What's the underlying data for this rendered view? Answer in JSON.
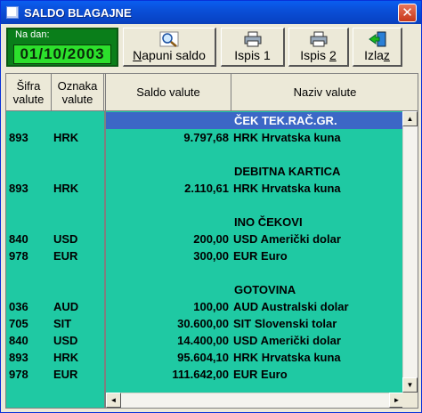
{
  "window": {
    "title": "SALDO BLAGAJNE"
  },
  "date": {
    "label": "Na dan:",
    "value": "01/10/2003"
  },
  "toolbar": {
    "fill": {
      "pre": "",
      "u": "N",
      "post": "apuni saldo"
    },
    "print1": {
      "pre": "Ispis 1",
      "u": "",
      "post": ""
    },
    "print2": {
      "pre": "Ispis ",
      "u": "2",
      "post": ""
    },
    "exit": {
      "pre": "Izla",
      "u": "z",
      "post": ""
    }
  },
  "columns": {
    "sifra": "Šifra valute",
    "oznaka": "Oznaka valute",
    "saldo": "Saldo valute",
    "naziv": "Naziv valute"
  },
  "groups": [
    {
      "name": "ČEK TEK.RAČ.GR.",
      "active": true,
      "rows": [
        {
          "sifra": "893",
          "oznaka": "HRK",
          "saldo": "9.797,68",
          "naziv": "HRK Hrvatska kuna"
        }
      ]
    },
    {
      "name": "DEBITNA KARTICA",
      "active": false,
      "rows": [
        {
          "sifra": "893",
          "oznaka": "HRK",
          "saldo": "2.110,61",
          "naziv": "HRK Hrvatska kuna"
        }
      ]
    },
    {
      "name": "INO ČEKOVI",
      "active": false,
      "rows": [
        {
          "sifra": "840",
          "oznaka": "USD",
          "saldo": "200,00",
          "naziv": "USD Američki dolar"
        },
        {
          "sifra": "978",
          "oznaka": "EUR",
          "saldo": "300,00",
          "naziv": "EUR Euro"
        }
      ]
    },
    {
      "name": "GOTOVINA",
      "active": false,
      "rows": [
        {
          "sifra": "036",
          "oznaka": "AUD",
          "saldo": "100,00",
          "naziv": "AUD Australski dolar"
        },
        {
          "sifra": "705",
          "oznaka": "SIT",
          "saldo": "30.600,00",
          "naziv": "SIT Slovenski tolar"
        },
        {
          "sifra": "840",
          "oznaka": "USD",
          "saldo": "14.400,00",
          "naziv": "USD Američki dolar"
        },
        {
          "sifra": "893",
          "oznaka": "HRK",
          "saldo": "95.604,10",
          "naziv": "HRK Hrvatska kuna"
        },
        {
          "sifra": "978",
          "oznaka": "EUR",
          "saldo": "111.642,00",
          "naziv": "EUR Euro"
        }
      ]
    }
  ],
  "scroll": {
    "up": "▲",
    "down": "▼",
    "left": "◄",
    "right": "►"
  }
}
